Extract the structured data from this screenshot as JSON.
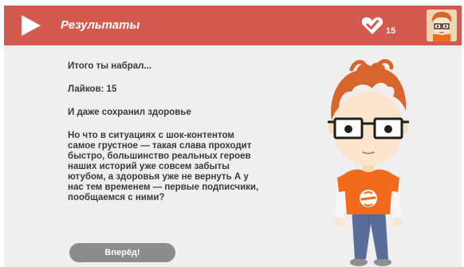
{
  "header": {
    "title": "Результаты",
    "likes_count": "15",
    "play_icon": "play-icon",
    "heart_icon": "heart-icon",
    "avatar_icon": "character-avatar"
  },
  "result": {
    "intro": "Итого ты набрал...",
    "likes_line": "Лайков: 15",
    "health_line": "И даже сохранил здоровье",
    "story": "Но что в ситуациях с шок-контентом\nсамое грустное — такая слава проходит\nбыстро, большинство реальных героев\nнаших историй уже совсем забыты\nютубом, а здоровья уже не вернуть А у\nнас тем временем — первые подписчики,\nпообщаемся с ними?"
  },
  "actions": {
    "next_label": "Вперёд!"
  },
  "colors": {
    "header_bg": "#d4594f",
    "content_bg": "#efefef",
    "button_bg": "#8c8c8c",
    "shirt": "#f26a1b",
    "hair": "#d8662c",
    "jeans": "#5a6c9a"
  }
}
